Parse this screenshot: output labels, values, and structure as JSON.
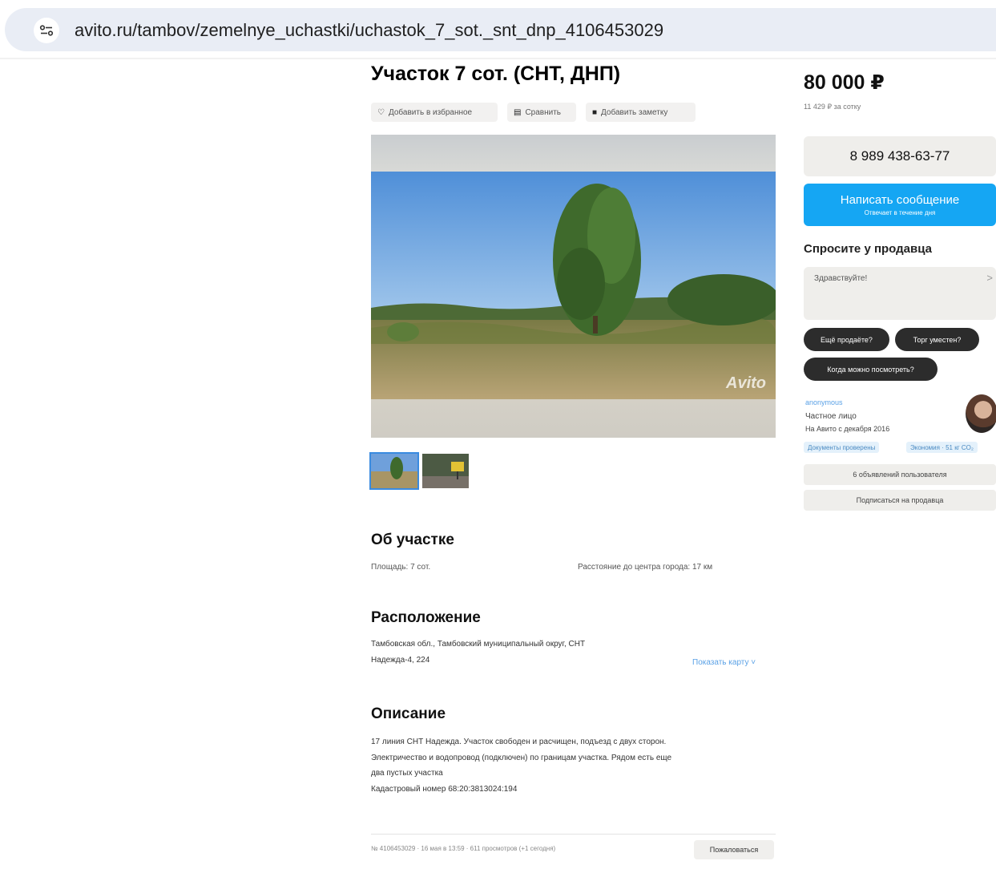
{
  "browser": {
    "url": "avito.ru/tambov/zemelnye_uchastki/uchastok_7_sot._snt_dnp_4106453029",
    "tune_icon": "site-settings-icon"
  },
  "listing": {
    "title": "Участок 7 сот. (СНТ, ДНП)",
    "actions": {
      "favorite": "Добавить в избранное",
      "compare": "Сравнить",
      "note": "Добавить заметку"
    },
    "photo_watermark": "Avito",
    "thumbnails_count": 2
  },
  "about": {
    "heading": "Об участке",
    "area": "Площадь: 7 сот.",
    "distance": "Расстояние до центра города: 17 км"
  },
  "location": {
    "heading": "Расположение",
    "address_line1": "Тамбовская обл., Тамбовский муниципальный округ, СНТ",
    "address_line2": "Надежда-4, 224",
    "map_link": "Показать карту"
  },
  "description": {
    "heading": "Описание",
    "line1": "17 линия СНТ Надежда. Участок свободен и расчищен, подъезд с двух сторон.",
    "line2": "Электричество и водопровод (подключен) по границам участка. Рядом есть еще",
    "line3": "два пустых участка",
    "line4": "Кадастровый номер 68:20:3813024:194"
  },
  "footer": {
    "meta": "№ 4106453029 · 16 мая в 13:59 · 611 просмотров (+1 сегодня)",
    "report": "Пожаловаться"
  },
  "sidebar": {
    "price": "80 000 ₽",
    "price_per_unit": "11 429 ₽ за сотку",
    "phone": "8 989 438-63-77",
    "message_button": "Написать сообщение",
    "message_sub": "Отвечает в течение дня",
    "ask_title": "Спросите у продавца",
    "ask_placeholder": "Здравствуйте!",
    "chips": [
      "Ещё продаёте?",
      "Торг уместен?",
      "Когда можно посмотреть?"
    ],
    "seller_name": "anonymous",
    "seller_type": "Частное лицо",
    "seller_since": "На Авито с декабря 2016",
    "tags": [
      "Документы проверены",
      "Экономия · 51 кг CO₂"
    ],
    "btn_listings": "6 объявлений пользователя",
    "btn_subscribe": "Подписаться на продавца"
  },
  "colors": {
    "accent_blue": "#15a6f3",
    "link_blue": "#5aa1e6",
    "chip_dark": "#2c2c2c",
    "button_gray": "#efeeeb"
  }
}
